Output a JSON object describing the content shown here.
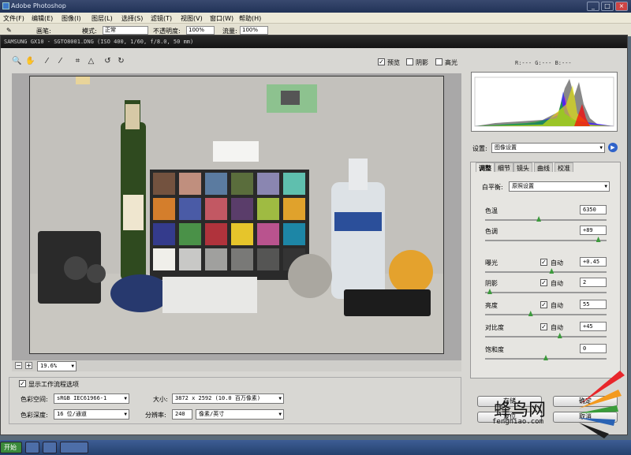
{
  "app": {
    "title": "Adobe Photoshop"
  },
  "menus": [
    "文件(F)",
    "编辑(E)",
    "图像(I)",
    "图层(L)",
    "选择(S)",
    "滤镜(T)",
    "视图(V)",
    "窗口(W)",
    "帮助(H)"
  ],
  "options": {
    "brush_label": "画笔:",
    "mode_label": "模式:",
    "mode_value": "正常",
    "opacity_label": "不透明度:",
    "opacity_value": "100%",
    "flow_label": "流量:",
    "flow_value": "100%"
  },
  "dialog": {
    "title": "SAMSUNG GX10 - SGTO8001.DNG (ISO 400, 1/60, f/8.0, 50 mm)",
    "preview_label": "预览",
    "shadows_label": "阴影",
    "highlights_label": "高光",
    "preview_checked": true,
    "zoom_value": "19.6%",
    "show_workflow_label": "显示工作流程选项",
    "color_space_label": "色彩空间:",
    "color_space_value": "sRGB IEC61966-1",
    "color_depth_label": "色彩深度:",
    "color_depth_value": "16 位/通道",
    "size_label": "大小:",
    "size_value": "3872 x 2592 (10.0 百万像素)",
    "resolution_label": "分辨率:",
    "resolution_value": "240",
    "resolution_unit": "像素/英寸",
    "rgb_readout": "R:---  G:---  B:---",
    "settings_label": "设置:",
    "settings_value": "图像设置",
    "tabs": [
      "调整",
      "细节",
      "镜头",
      "曲线",
      "校准"
    ],
    "white_balance_label": "白平衡:",
    "white_balance_value": "原照设置",
    "adjustments": [
      {
        "label": "色温",
        "value": "6350",
        "auto": false,
        "level": 0.44
      },
      {
        "label": "色调",
        "value": "+89",
        "auto": false,
        "level": 0.95
      },
      {
        "label": "曝光",
        "value": "+0.45",
        "auto": true,
        "level": 0.55
      },
      {
        "label": "阴影",
        "value": "2",
        "auto": true,
        "level": 0.02
      },
      {
        "label": "亮度",
        "value": "55",
        "auto": true,
        "level": 0.37
      },
      {
        "label": "对比度",
        "value": "+45",
        "auto": true,
        "level": 0.62
      },
      {
        "label": "饱和度",
        "value": "0",
        "auto": false,
        "level": 0.5
      }
    ],
    "auto_label": "自动",
    "save_button": "存储",
    "ok_button": "确定",
    "cancel_button": "取消",
    "reset_button": "复位"
  },
  "taskbar": {
    "start": "开始"
  },
  "watermark": {
    "cn": "蜂鸟网",
    "url": "fengniao.com"
  },
  "colors": {
    "accent_green": "#3c9a3c",
    "title_dark": "#1c1c1c",
    "taskbar": "#25416e"
  }
}
